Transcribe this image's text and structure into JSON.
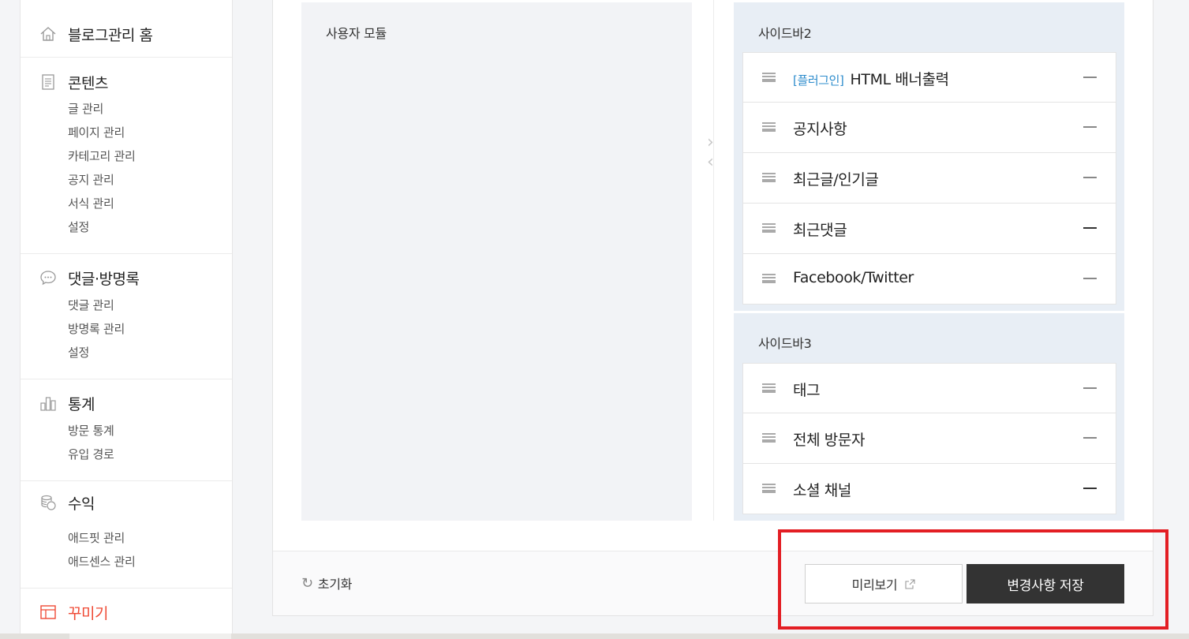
{
  "sidebar": {
    "home": {
      "label": "블로그관리 홈",
      "icon": "home-icon"
    },
    "content": {
      "label": "콘텐츠",
      "icon": "document-icon",
      "items": [
        "글 관리",
        "페이지 관리",
        "카테고리 관리",
        "공지 관리",
        "서식 관리",
        "설정"
      ]
    },
    "comments": {
      "label": "댓글·방명록",
      "icon": "speech-bubble-icon",
      "items": [
        "댓글 관리",
        "방명록 관리",
        "설정"
      ]
    },
    "stats": {
      "label": "통계",
      "icon": "bar-chart-icon",
      "items": [
        "방문 통계",
        "유입 경로"
      ]
    },
    "revenue": {
      "label": "수익",
      "icon": "coins-icon",
      "items": [
        "애드핏 관리",
        "애드센스 관리"
      ]
    },
    "design": {
      "label": "꾸미기",
      "icon": "layout-icon",
      "accent": "#ef4a35"
    }
  },
  "main": {
    "module_pool_title": "사용자 모듈",
    "sidebar2": {
      "title": "사이드바2",
      "items": [
        {
          "tag": "[플러그인]",
          "name": "HTML 배너출력"
        },
        {
          "tag": "",
          "name": "공지사항"
        },
        {
          "tag": "",
          "name": "최근글/인기글"
        },
        {
          "tag": "",
          "name": "최근댓글"
        },
        {
          "tag": "",
          "name": "Facebook/Twitter"
        }
      ]
    },
    "sidebar3": {
      "title": "사이드바3",
      "items": [
        {
          "tag": "",
          "name": "태그"
        },
        {
          "tag": "",
          "name": "전체 방문자"
        },
        {
          "tag": "",
          "name": "소셜 채널"
        }
      ]
    }
  },
  "footer": {
    "reset_label": "초기화",
    "preview_label": "미리보기",
    "save_label": "변경사항 저장"
  },
  "colors": {
    "accent": "#ef4a35",
    "plugin_tag": "#2d8ccc",
    "save_button": "#333333",
    "highlight": "#e31e24"
  }
}
